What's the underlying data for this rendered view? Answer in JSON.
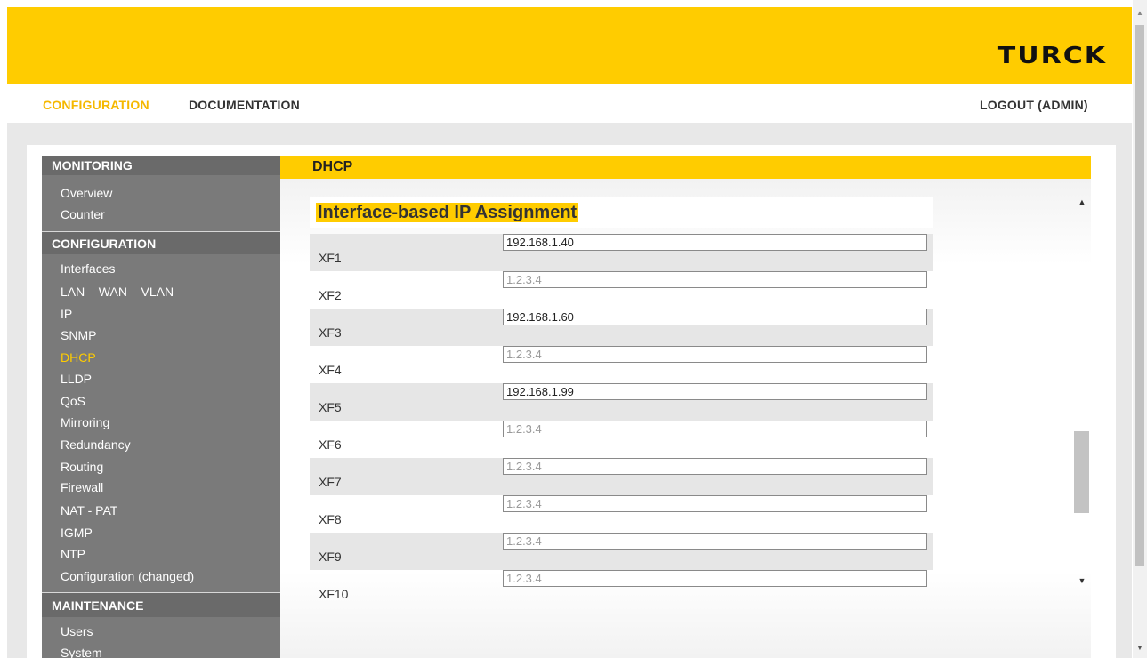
{
  "header": {
    "logo_text": "TURCK"
  },
  "nav": {
    "configuration": "CONFIGURATION",
    "documentation": "DOCUMENTATION",
    "logout": "LOGOUT (ADMIN)"
  },
  "sidebar": {
    "monitoring": {
      "title": "MONITORING",
      "items": [
        "Overview",
        "Counter"
      ]
    },
    "configuration": {
      "title": "CONFIGURATION",
      "items": [
        "Interfaces",
        "LAN – WAN – VLAN",
        "IP",
        "SNMP",
        "DHCP",
        "LLDP",
        "QoS",
        "Mirroring",
        "Redundancy",
        "Routing",
        "Firewall",
        "NAT - PAT",
        "IGMP",
        "NTP",
        "Configuration (changed)"
      ]
    },
    "maintenance": {
      "title": "MAINTENANCE",
      "items": [
        "Users",
        "System"
      ]
    }
  },
  "main": {
    "title": "DHCP",
    "section_title": "Interface-based IP Assignment",
    "rows": [
      {
        "label": "XF1",
        "value": "192.168.1.40",
        "placeholder": ""
      },
      {
        "label": "XF2",
        "value": "",
        "placeholder": "1.2.3.4"
      },
      {
        "label": "XF3",
        "value": "192.168.1.60",
        "placeholder": ""
      },
      {
        "label": "XF4",
        "value": "",
        "placeholder": "1.2.3.4"
      },
      {
        "label": "XF5",
        "value": "192.168.1.99",
        "placeholder": ""
      },
      {
        "label": "XF6",
        "value": "",
        "placeholder": "1.2.3.4"
      },
      {
        "label": "XF7",
        "value": "",
        "placeholder": "1.2.3.4"
      },
      {
        "label": "XF8",
        "value": "",
        "placeholder": "1.2.3.4"
      },
      {
        "label": "XF9",
        "value": "",
        "placeholder": "1.2.3.4"
      },
      {
        "label": "XF10",
        "value": "",
        "placeholder": "1.2.3.4"
      }
    ]
  },
  "colors": {
    "brand_yellow": "#ffcc00",
    "sidebar_gray": "#7a7a7a",
    "active_nav": "#f5b800"
  },
  "icons": {
    "scroll_up": "triangle-up-icon",
    "scroll_down": "triangle-down-icon"
  }
}
